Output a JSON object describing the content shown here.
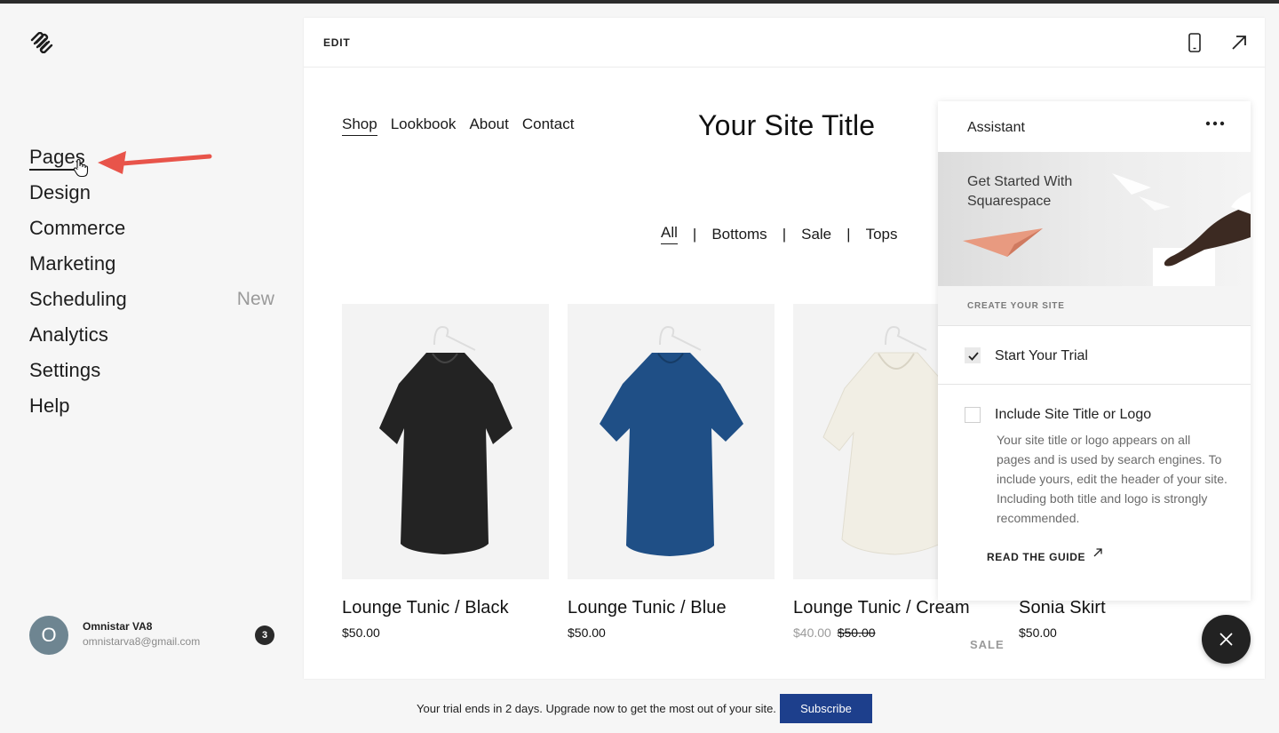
{
  "sidebar": {
    "items": [
      {
        "label": "Pages"
      },
      {
        "label": "Design"
      },
      {
        "label": "Commerce"
      },
      {
        "label": "Marketing"
      },
      {
        "label": "Scheduling",
        "badge": "New"
      },
      {
        "label": "Analytics"
      },
      {
        "label": "Settings"
      },
      {
        "label": "Help"
      }
    ],
    "user": {
      "initial": "O",
      "name": "Omnistar VA8",
      "email": "omnistarva8@gmail.com",
      "notifications": "3"
    }
  },
  "editor": {
    "edit_label": "EDIT",
    "site": {
      "nav": [
        "Shop",
        "Lookbook",
        "About",
        "Contact"
      ],
      "title": "Your Site Title",
      "filters": [
        "All",
        "Bottoms",
        "Sale",
        "Tops"
      ],
      "separator": "|",
      "products": [
        {
          "name": "Lounge Tunic / Black",
          "price": "$50.00",
          "color": "#232323"
        },
        {
          "name": "Lounge Tunic / Blue",
          "price": "$50.00",
          "color": "#1f4f86"
        },
        {
          "name": "Lounge Tunic / Cream",
          "sale_price": "$40.00",
          "old_price": "$50.00",
          "color": "#f1eee4"
        },
        {
          "name": "Sonia Skirt",
          "price": "$50.00"
        }
      ],
      "sale_tag": "SALE"
    }
  },
  "assistant": {
    "title": "Assistant",
    "hero_text": "Get Started With Squarespace",
    "section_label": "CREATE YOUR SITE",
    "tasks": [
      {
        "label": "Start Your Trial",
        "checked": true
      },
      {
        "label": "Include Site Title or Logo",
        "checked": false,
        "description": "Your site title or logo appears on all pages and is used by search engines. To include yours, edit the header of your site. Including both title and logo is strongly recommended.",
        "link": "READ THE GUIDE"
      }
    ]
  },
  "trial_bar": {
    "text": "Your trial ends in 2 days. Upgrade now to get the most out of your site.",
    "button": "Subscribe"
  },
  "colors": {
    "accent": "#1d3f8c",
    "annotation_arrow": "#e8544a"
  }
}
